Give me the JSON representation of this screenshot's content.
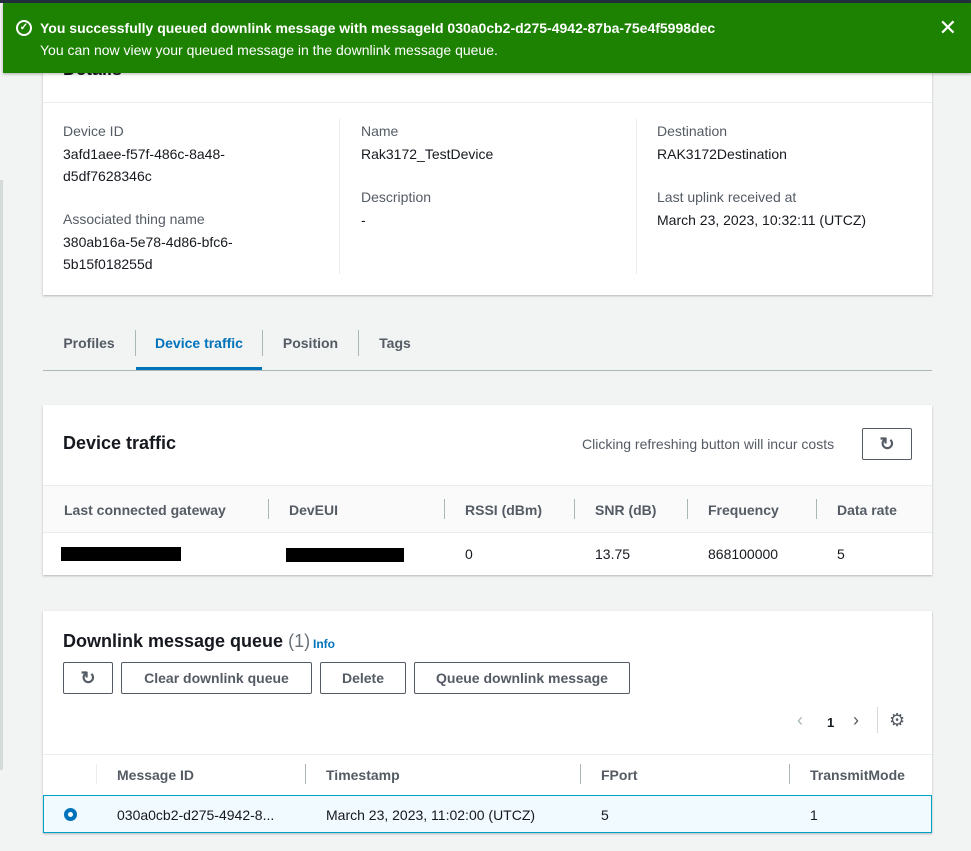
{
  "flash": {
    "title": "You successfully queued downlink message with messageId 030a0cb2-d275-4942-87ba-75e4f5998dec",
    "message": "You can now view your queued message in the downlink message queue.",
    "color": "#1d8102"
  },
  "details": {
    "title": "Details",
    "device_id_label": "Device ID",
    "device_id_1": "3afd1aee-f57f-486c-8a48-",
    "device_id_2": "d5df7628346c",
    "thing_label": "Associated thing name",
    "thing_1": "380ab16a-5e78-4d86-bfc6-",
    "thing_2": "5b15f018255d",
    "name_label": "Name",
    "name": "Rak3172_TestDevice",
    "description_label": "Description",
    "description": "-",
    "destination_label": "Destination",
    "destination": "RAK3172Destination",
    "uplink_label": "Last uplink received at",
    "uplink": "March 23, 2023, 10:32:11 (UTCZ)"
  },
  "tabs": [
    "Profiles",
    "Device traffic",
    "Position",
    "Tags"
  ],
  "traffic": {
    "title": "Device traffic",
    "note": "Clicking refreshing button will incur costs",
    "columns": [
      "Last connected gateway",
      "DevEUI",
      "RSSI (dBm)",
      "SNR (dB)",
      "Frequency",
      "Data rate"
    ],
    "row": {
      "rssi": "0",
      "snr": "13.75",
      "frequency": "868100000",
      "data_rate": "5"
    }
  },
  "queue": {
    "title": "Downlink message queue",
    "count": "(1)",
    "info": "Info",
    "buttons": {
      "clear": "Clear downlink queue",
      "delete": "Delete",
      "queue": "Queue downlink message"
    },
    "page": "1",
    "columns": [
      "Message ID",
      "Timestamp",
      "FPort",
      "TransmitMode"
    ],
    "row": {
      "message_id": "030a0cb2-d275-4942-8...",
      "timestamp": "March 23, 2023, 11:02:00 (UTCZ)",
      "fport": "5",
      "transmit_mode": "1"
    }
  },
  "accent": "#0073bb"
}
